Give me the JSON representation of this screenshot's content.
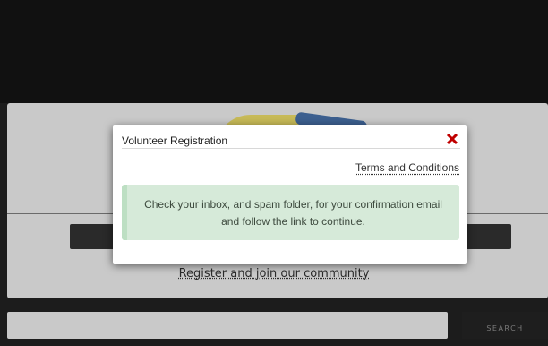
{
  "modal": {
    "title": "Volunteer Registration",
    "terms_link": "Terms and Conditions",
    "message": "Check your inbox, and spam folder, for your confirmation email and follow the link to continue.",
    "close_icon": "close-icon",
    "close_color": "#c00000"
  },
  "background": {
    "register_link": "Register and join our community",
    "search_button": "SEARCH"
  }
}
